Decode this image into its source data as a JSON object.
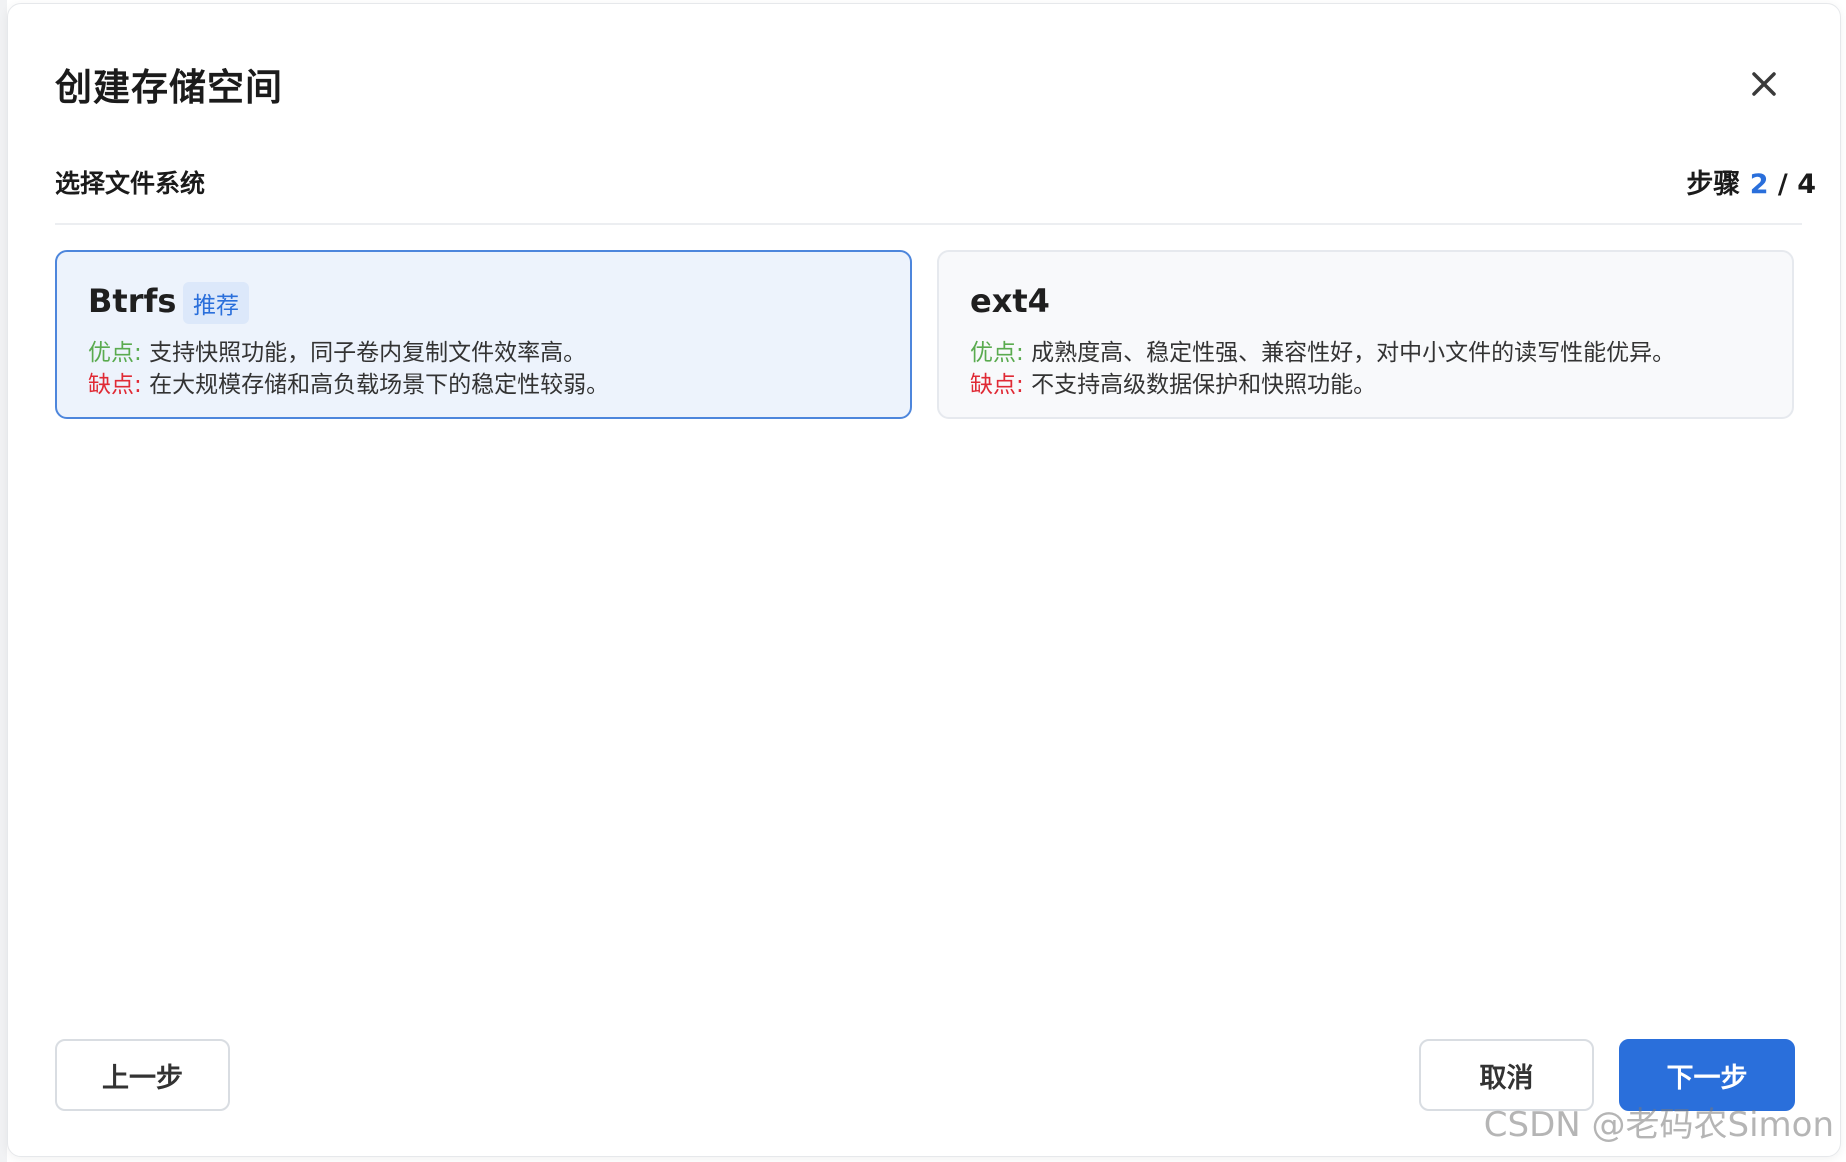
{
  "dialog": {
    "title": "创建存储空间",
    "subtitle": "选择文件系统",
    "step": {
      "label": "步骤",
      "current": "2",
      "separator": "/",
      "total": "4"
    }
  },
  "options": [
    {
      "name": "Btrfs",
      "badge": "推荐",
      "selected": true,
      "pros_label": "优点:",
      "pros": "支持快照功能，同子卷内复制文件效率高。",
      "cons_label": "缺点:",
      "cons": "在大规模存储和高负载场景下的稳定性较弱。"
    },
    {
      "name": "ext4",
      "selected": false,
      "pros_label": "优点:",
      "pros": "成熟度高、稳定性强、兼容性好，对中小文件的读写性能优异。",
      "cons_label": "缺点:",
      "cons": "不支持高级数据保护和快照功能。"
    }
  ],
  "buttons": {
    "prev": "上一步",
    "cancel": "取消",
    "next": "下一步"
  },
  "watermark": "CSDN @老码农Simon",
  "icons": {
    "close": "close-icon"
  },
  "colors": {
    "accent": "#2a6fdb",
    "pros": "#5aab4f",
    "cons": "#e02a35",
    "selected_bg": "#edf3fc",
    "selected_border": "#4d86dc"
  }
}
